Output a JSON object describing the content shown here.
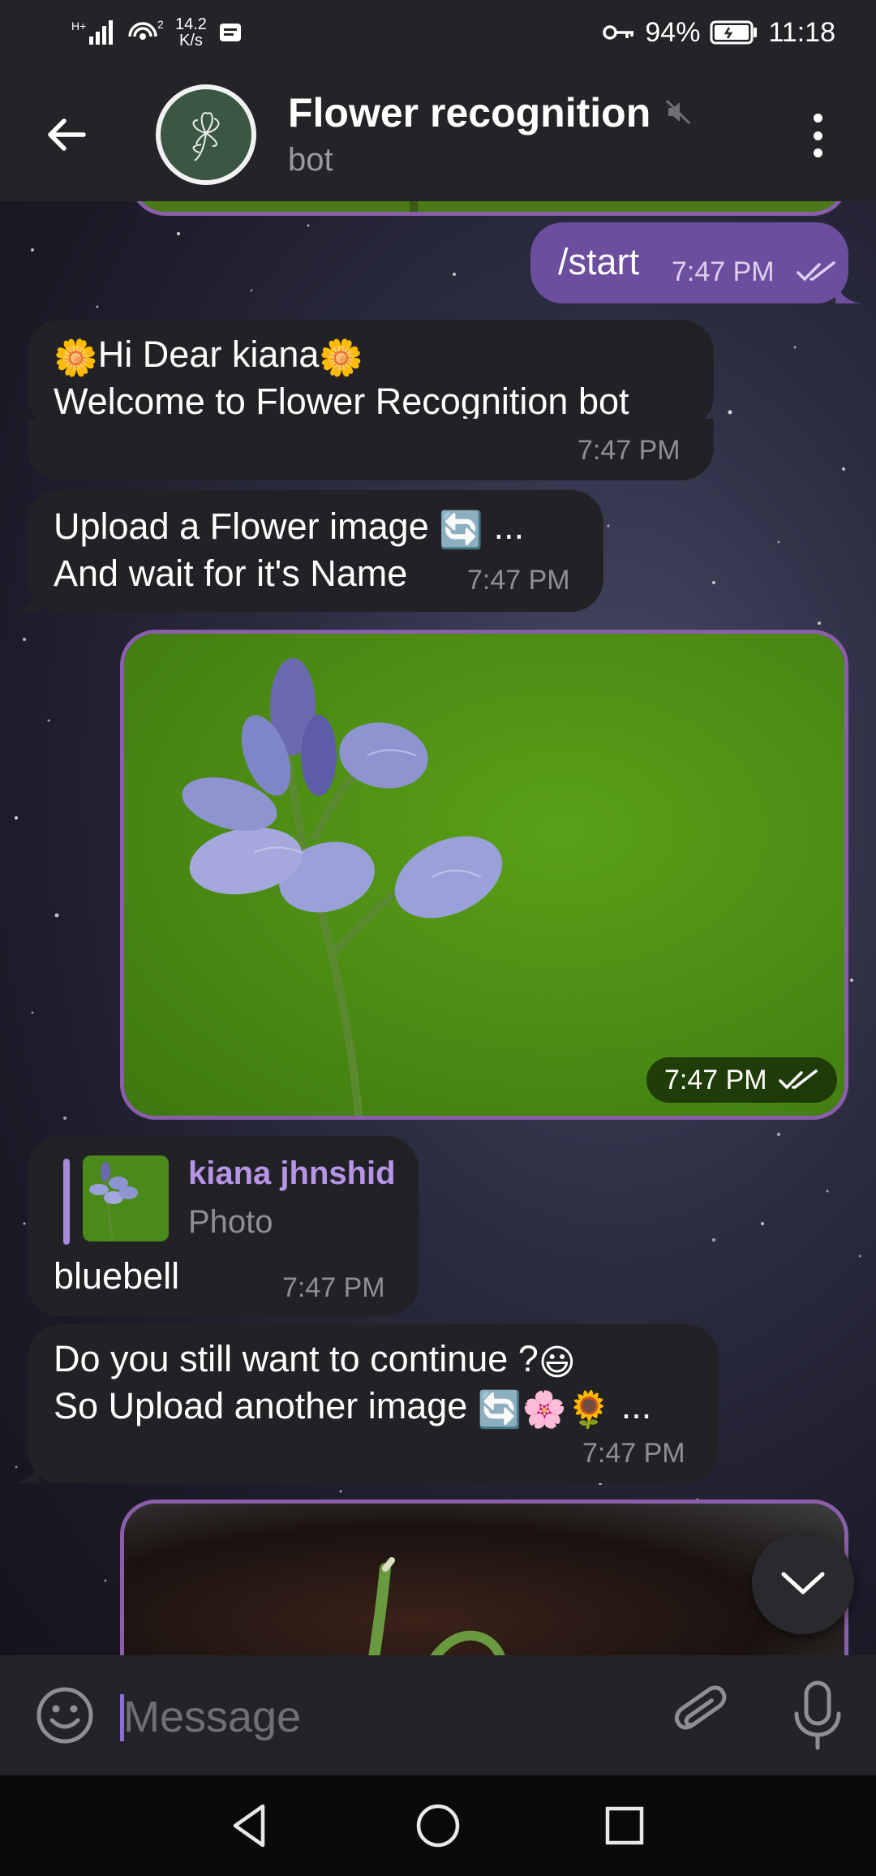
{
  "status_bar": {
    "network": "H+",
    "signal_superscript": "2",
    "speed_value": "14.2",
    "speed_unit": "K/s",
    "battery": "94%",
    "time": "11:18"
  },
  "header": {
    "title": "Flower recognition",
    "subtitle": "bot"
  },
  "messages": {
    "start": {
      "text": "/start",
      "time": "7:47 PM"
    },
    "welcome": {
      "line1": "Hi Dear kiana",
      "line2": "Welcome to Flower Recognition bot",
      "time": "7:47 PM"
    },
    "upload": {
      "line1": "Upload a Flower image",
      "line1_suffix": "...",
      "line2": "And wait for it's Name",
      "time": "7:47 PM"
    },
    "photo": {
      "time": "7:47 PM"
    },
    "reply": {
      "author": "kiana jhnshid",
      "type": "Photo",
      "text": "bluebell",
      "time": "7:47 PM"
    },
    "continue": {
      "line1": "Do you still want to continue ?",
      "line2": "So Upload another image",
      "line2_suffix": "...",
      "time": "7:47 PM"
    }
  },
  "input": {
    "placeholder": "Message"
  },
  "colors": {
    "outgoing_bubble": "#6b4e9e",
    "incoming_bubble": "#222226",
    "accent": "#b694e6",
    "photo_border": "#8a5ea8"
  },
  "icons": [
    "back-arrow-icon",
    "bot-avatar-flower",
    "mute-icon",
    "more-vert-icon",
    "double-check-icon",
    "sunflower-emoji",
    "refresh-emoji",
    "smile-emoji",
    "cherry-blossom-emoji",
    "chevron-down-icon",
    "emoji-icon",
    "paperclip-icon",
    "mic-icon",
    "nav-back-icon",
    "nav-home-icon",
    "nav-recents-icon"
  ]
}
